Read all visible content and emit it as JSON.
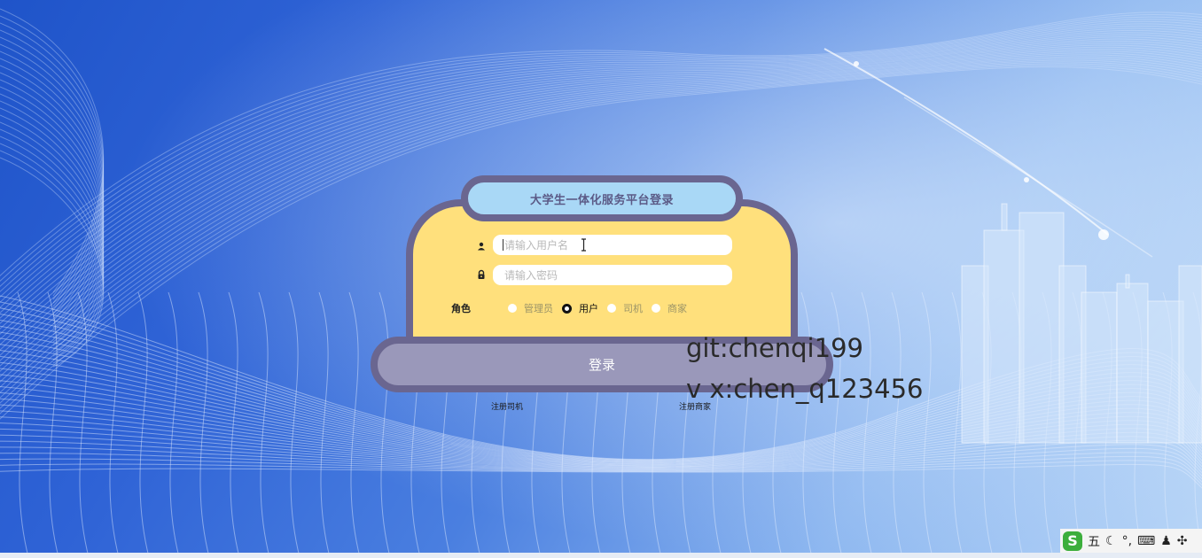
{
  "login": {
    "title": "大学生一体化服务平台登录",
    "username_placeholder": "请输入用户名",
    "password_placeholder": "请输入密码",
    "role_label": "角色",
    "roles": [
      {
        "label": "管理员",
        "checked": false
      },
      {
        "label": "用户",
        "checked": true
      },
      {
        "label": "司机",
        "checked": false
      },
      {
        "label": "商家",
        "checked": false
      }
    ],
    "submit_label": "登录",
    "register_driver": "注册司机",
    "register_merchant": "注册商家"
  },
  "watermark": {
    "line1": "git:chenqi199",
    "line2": "v x:chen_q123456"
  },
  "ime": {
    "logo": "S",
    "mode": "五",
    "items": [
      "moon-icon",
      "punctuation-icon",
      "keyboard-icon",
      "user-icon",
      "grid-icon"
    ]
  },
  "colors": {
    "panel_yellow": "#ffe07c",
    "title_blue": "#a9d8f6",
    "frame_purple": "#6a6690",
    "button_lavender": "#9a98ba"
  }
}
